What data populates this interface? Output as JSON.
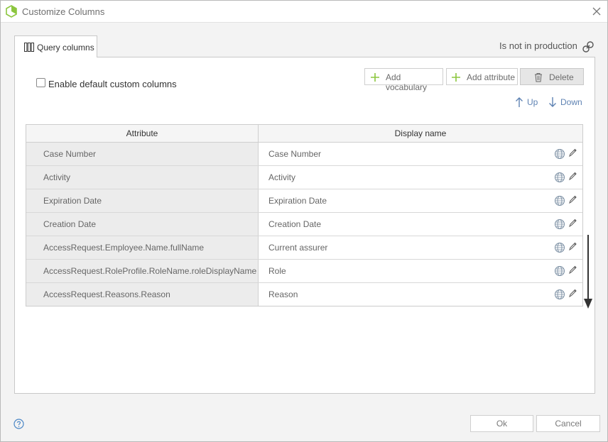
{
  "window": {
    "title": "Customize Columns"
  },
  "tabs": [
    {
      "label": "Query columns"
    }
  ],
  "production_status": "Is not in production",
  "options": {
    "enable_default_label": "Enable default custom columns",
    "enable_default_checked": false
  },
  "toolbar": {
    "add_vocabulary": "Add vocabulary",
    "add_attribute": "Add attribute",
    "delete": "Delete"
  },
  "move": {
    "up": "Up",
    "down": "Down"
  },
  "table": {
    "headers": [
      "Attribute",
      "Display name"
    ],
    "rows": [
      {
        "attribute": "Case Number",
        "display": "Case Number"
      },
      {
        "attribute": "Activity",
        "display": "Activity"
      },
      {
        "attribute": "Expiration Date",
        "display": "Expiration Date"
      },
      {
        "attribute": "Creation Date",
        "display": "Creation Date"
      },
      {
        "attribute": "AccessRequest.Employee.Name.fullName",
        "display": "Current assurer"
      },
      {
        "attribute": "AccessRequest.RoleProfile.RoleName.roleDisplayName",
        "display": "Role"
      },
      {
        "attribute": "AccessRequest.Reasons.Reason",
        "display": "Reason"
      }
    ]
  },
  "footer": {
    "ok": "Ok",
    "cancel": "Cancel"
  },
  "colors": {
    "accent_green": "#8cc63f",
    "link_blue": "#5f83b3",
    "icon_gray": "#7b8fa3"
  }
}
